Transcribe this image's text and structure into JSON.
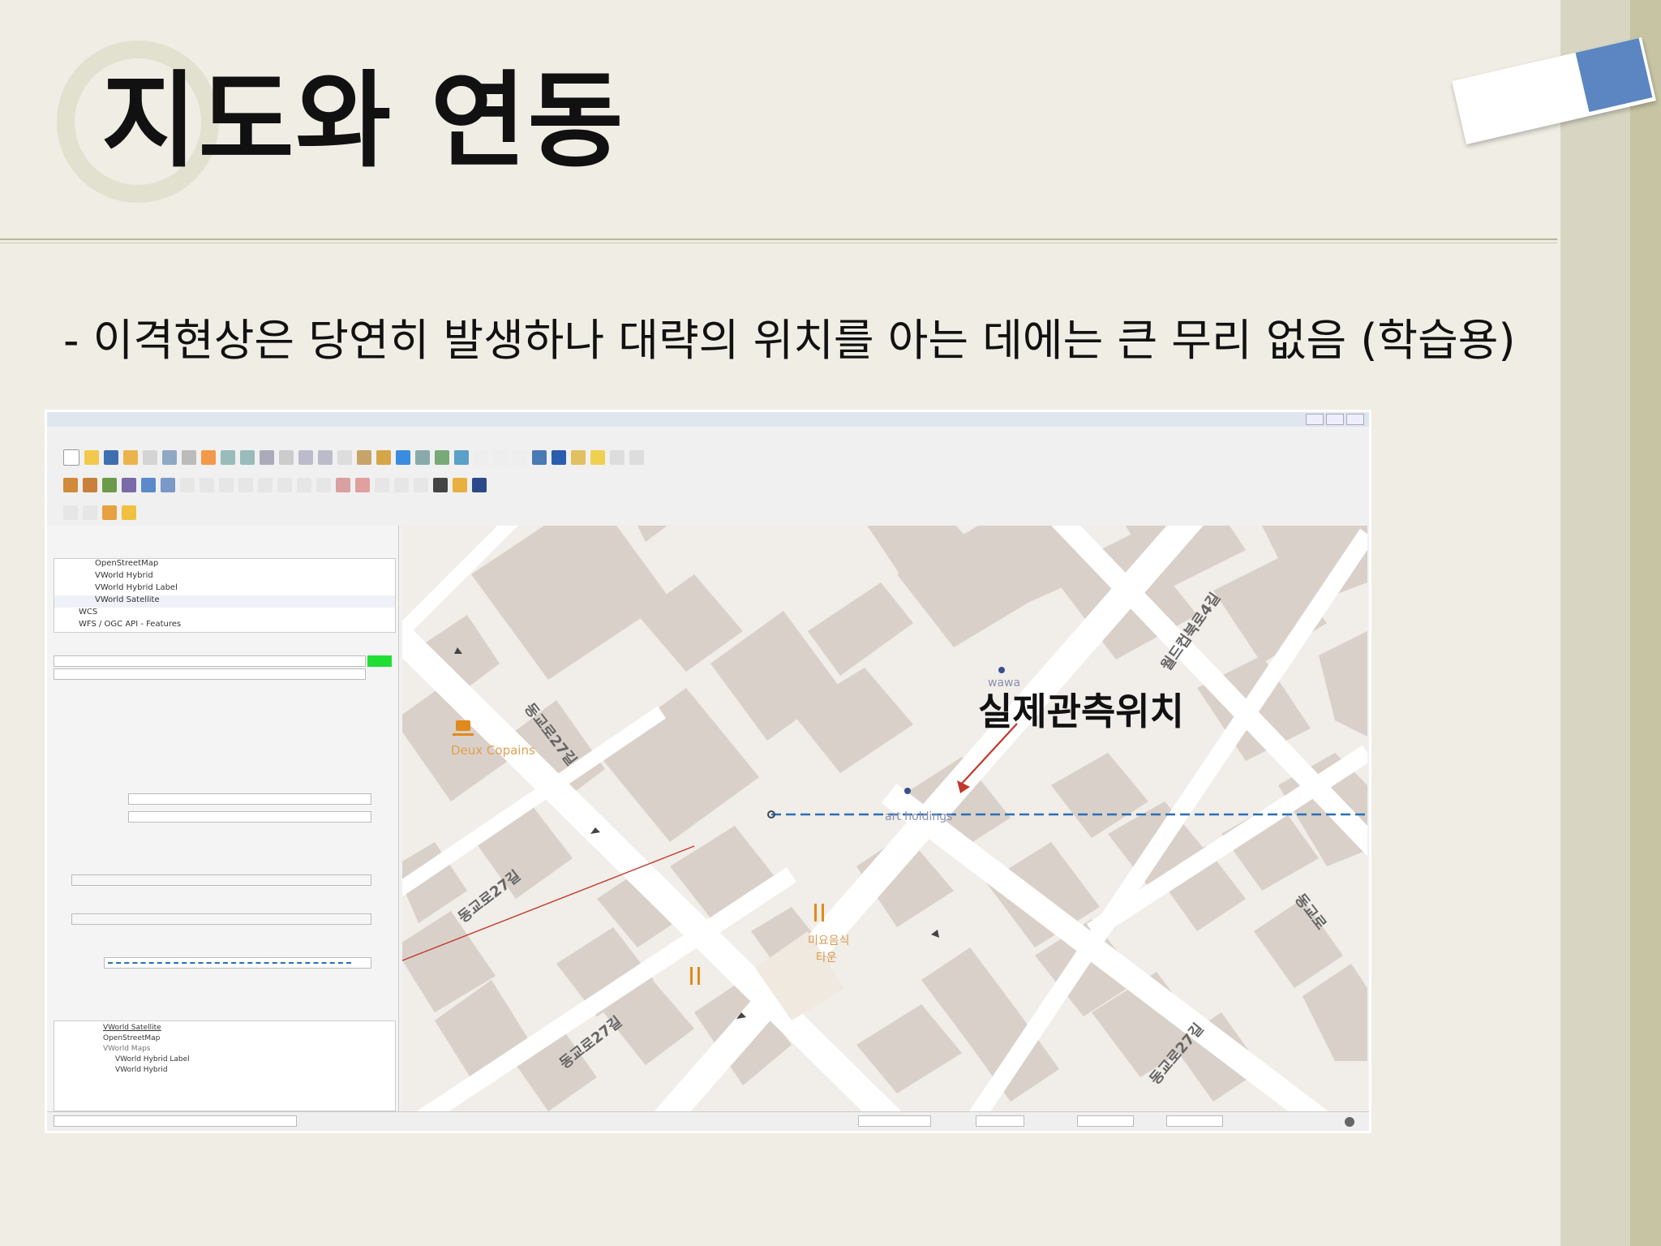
{
  "slide": {
    "title": "지도와 연동",
    "subtitle": "- 이격현상은 당연히 발생하나 대략의 위치를 아는 데에는 큰 무리 없음 (학습용)"
  },
  "qgis": {
    "browser_items": [
      "OpenStreetMap",
      "VWorld Hybrid",
      "VWorld Hybrid Label",
      "VWorld Satellite",
      "WCS",
      "WFS / OGC API - Features"
    ],
    "layers": [
      "VWorld Satellite",
      "OpenStreetMap",
      "VWorld Maps",
      "VWorld Hybrid Label",
      "VWorld Hybrid"
    ],
    "map_labels": {
      "annotation": "실제관측위치",
      "cafe": "Deux Copains",
      "shop": "wawa",
      "company": "art holdings",
      "restaurant_line1": "미요음식",
      "restaurant_line2": "타운",
      "road1": "동교로27길",
      "road2": "동교로27길",
      "road3": "동교로27길",
      "road4": "동교로27길",
      "road5": "월드컵북로4길",
      "road6": "동교로"
    }
  },
  "colors": {
    "background": "#efede4",
    "accent_blue": "#5b86c1",
    "map_building": "#d9d0c9",
    "map_road": "#ffffff",
    "gps_line": "#2a6fb5",
    "track_line": "#c0392b",
    "arrow": "#c0392b",
    "poi_orange": "#e08a1e",
    "poi_blue": "#3b4f8c"
  }
}
